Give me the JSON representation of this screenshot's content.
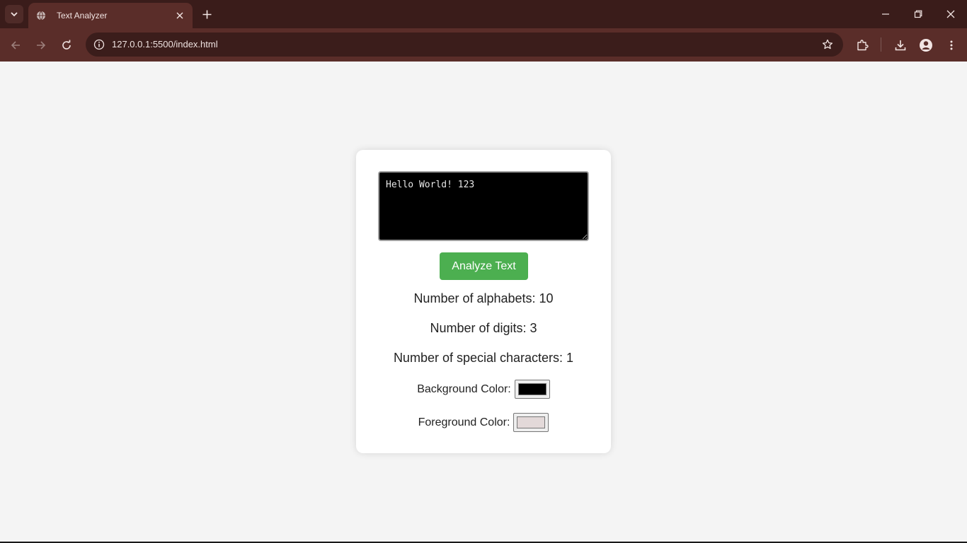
{
  "browser": {
    "tab_title": "Text Analyzer",
    "url": "127.0.0.1:5500/index.html"
  },
  "app": {
    "input_text": "Hello World! 123",
    "analyze_button": "Analyze Text",
    "results": {
      "alphabets": "Number of alphabets: 10",
      "digits": "Number of digits: 3",
      "special": "Number of special characters: 1"
    },
    "background_color_label": "Background Color:",
    "background_color_value": "#000000",
    "foreground_color_label": "Foreground Color:",
    "foreground_color_value": "#e3d9d9"
  },
  "colors": {
    "chrome_dark": "#3a1c1a",
    "chrome_tab": "#5a2d29",
    "button_green": "#4caf50",
    "page_bg": "#f4f4f4"
  }
}
